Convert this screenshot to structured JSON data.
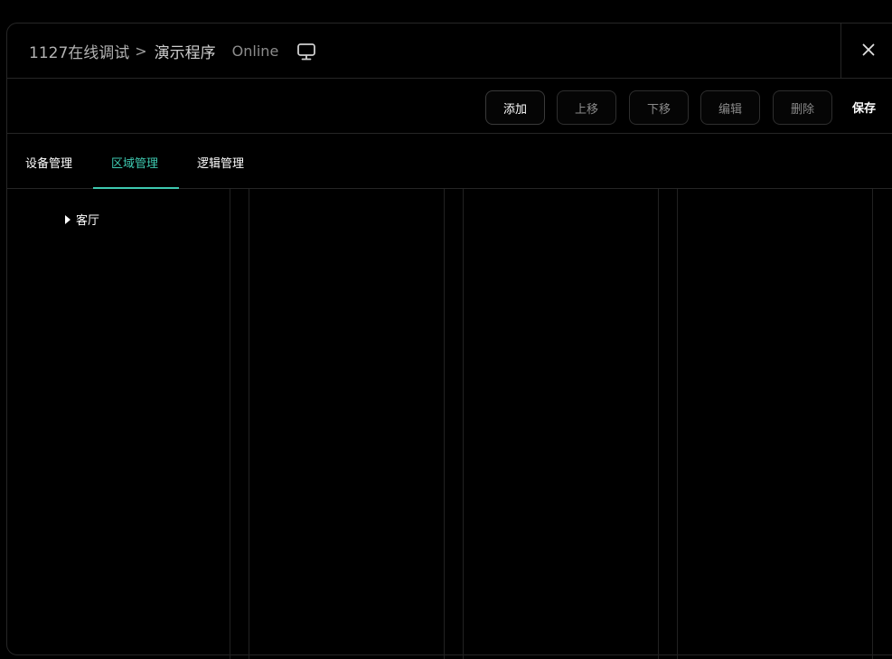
{
  "header": {
    "project": "1127在线调试",
    "separator": ">",
    "program": "演示程序",
    "status": "Online",
    "icons": {
      "monitor": "monitor-icon",
      "close": "close-icon"
    }
  },
  "toolbar": {
    "add_label": "添加",
    "up_label": "上移",
    "down_label": "下移",
    "edit_label": "编辑",
    "delete_label": "删除",
    "save_label": "保存"
  },
  "tabs": [
    {
      "label": "设备管理",
      "active": false
    },
    {
      "label": "区域管理",
      "active": true
    },
    {
      "label": "逻辑管理",
      "active": false
    }
  ],
  "tree": {
    "items": [
      {
        "label": "客厅",
        "expanded": false
      }
    ]
  },
  "colors": {
    "accent": "#3ec9b0",
    "background": "#000000",
    "border": "#262626"
  }
}
